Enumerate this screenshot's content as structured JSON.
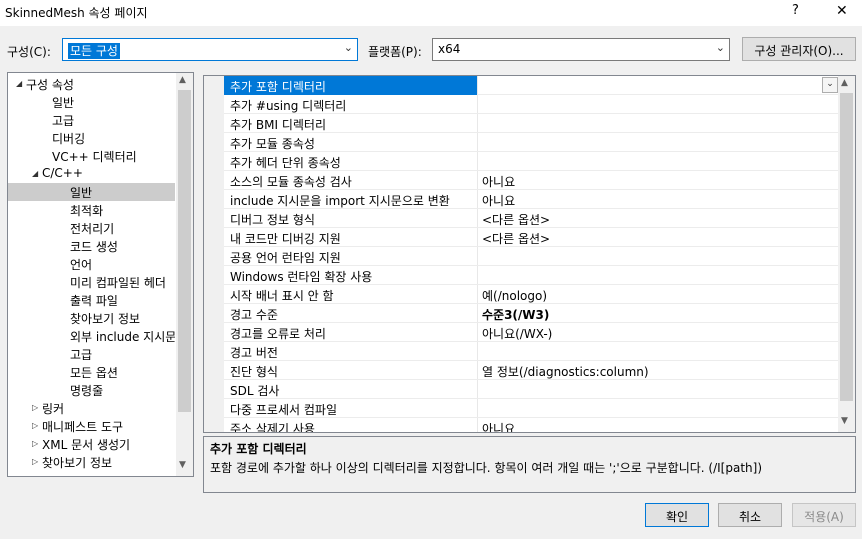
{
  "window": {
    "title": "SkinnedMesh 속성 페이지",
    "help_glyph": "?",
    "close_glyph": "✕"
  },
  "config": {
    "label": "구성(C):",
    "value": "모든 구성",
    "platform_label": "플랫폼(P):",
    "platform_value": "x64",
    "manager_button": "구성 관리자(O)..."
  },
  "tree": {
    "items": [
      {
        "label": "구성 속성",
        "expander": "◢"
      },
      {
        "label": "일반"
      },
      {
        "label": "고급"
      },
      {
        "label": "디버깅"
      },
      {
        "label": "VC++ 디렉터리"
      },
      {
        "label": "C/C++",
        "expander": "◢"
      },
      {
        "label": "일반"
      },
      {
        "label": "최적화"
      },
      {
        "label": "전처리기"
      },
      {
        "label": "코드 생성"
      },
      {
        "label": "언어"
      },
      {
        "label": "미리 컴파일된 헤더"
      },
      {
        "label": "출력 파일"
      },
      {
        "label": "찾아보기 정보"
      },
      {
        "label": "외부 include 지시문"
      },
      {
        "label": "고급"
      },
      {
        "label": "모든 옵션"
      },
      {
        "label": "명령줄"
      },
      {
        "label": "링커",
        "expander": "▷"
      },
      {
        "label": "매니페스트 도구",
        "expander": "▷"
      },
      {
        "label": "XML 문서 생성기",
        "expander": "▷"
      },
      {
        "label": "찾아보기 정보",
        "expander": "▷"
      }
    ],
    "selected_index": 6,
    "scroll_up": "▲",
    "scroll_down": "▼"
  },
  "grid": {
    "rows": [
      {
        "name": "추가 포함 디렉터리",
        "value": ""
      },
      {
        "name": "추가 #using 디렉터리",
        "value": ""
      },
      {
        "name": "추가 BMI 디렉터리",
        "value": ""
      },
      {
        "name": "추가 모듈 종속성",
        "value": ""
      },
      {
        "name": "추가 헤더 단위 종속성",
        "value": ""
      },
      {
        "name": "소스의 모듈 종속성 검사",
        "value": "아니요"
      },
      {
        "name": "include 지시문을 import 지시문으로 변환",
        "value": "아니요"
      },
      {
        "name": "디버그 정보 형식",
        "value": "<다른 옵션>"
      },
      {
        "name": "내 코드만 디버깅 지원",
        "value": "<다른 옵션>"
      },
      {
        "name": "공용 언어 런타임 지원",
        "value": ""
      },
      {
        "name": "Windows 런타임 확장 사용",
        "value": ""
      },
      {
        "name": "시작 배너 표시 안 함",
        "value": "예(/nologo)"
      },
      {
        "name": "경고 수준",
        "value": "수준3(/W3)"
      },
      {
        "name": "경고를 오류로 처리",
        "value": "아니요(/WX-)"
      },
      {
        "name": "경고 버전",
        "value": ""
      },
      {
        "name": "진단 형식",
        "value": "열 정보(/diagnostics:column)"
      },
      {
        "name": "SDL 검사",
        "value": ""
      },
      {
        "name": "다중 프로세서 컴파일",
        "value": ""
      },
      {
        "name": "주소 삭제기 사용",
        "value": "아니요"
      }
    ],
    "selected_index": 0,
    "bold_index": 12,
    "dropdown_glyph": "⌄",
    "scroll_up": "▲",
    "scroll_down": "▼"
  },
  "description": {
    "title": "추가 포함 디렉터리",
    "text": "포함 경로에 추가할 하나 이상의 디렉터리를 지정합니다. 항목이 여러 개일 때는 ';'으로 구분합니다. (/I[path])"
  },
  "buttons": {
    "ok": "확인",
    "cancel": "취소",
    "apply": "적용(A)"
  }
}
